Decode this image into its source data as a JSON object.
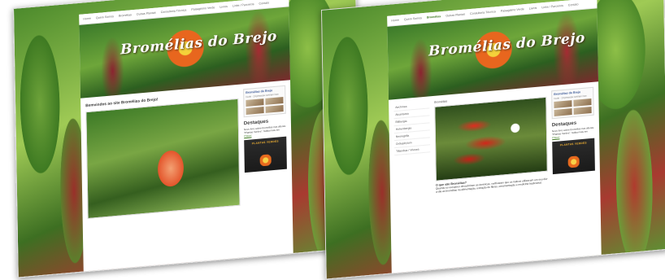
{
  "left": {
    "nav": [
      "Home",
      "Quem Somos",
      "Bromélias",
      "Outras Plantas",
      "Consultoria Técnica",
      "Paisagismo Verde",
      "Livros",
      "Links / Parceiros",
      "Contato"
    ],
    "site_title": "Bromélias do Brejo",
    "post_title": "Bemvindos ao site Bromélias do Brejo!",
    "fb_title": "Bromélias do Brejo",
    "fb_meta": "Curtir · 23 pessoas curtiram isso",
    "destaques_title": "Destaques",
    "destaques_text": "Novo livro sobre bromélias nas alturas: \"Plantas Verdes\". Saiba mais em",
    "destaques_link": "Clique!",
    "book_title": "PLANTAS VERDES"
  },
  "right": {
    "nav": [
      "Home",
      "Quem Somos",
      "Bromélias",
      "Outras Plantas",
      "Consultoria Técnica",
      "Paisagismo Verde",
      "Livros",
      "Links / Parceiros",
      "Contato"
    ],
    "active_nav": "Bromélias",
    "site_title": "Bromélias do Brejo",
    "section_label": "Bromélias",
    "side_menu": [
      "Aechmea",
      "Alcantarea",
      "Billbergia",
      "Hohenbergia",
      "Neoregelia",
      "Orthophytum",
      "Tillandsia / Vriesea"
    ],
    "caption_title": "O que são Bromélias?",
    "caption_text": "Quando os europeus descobriram as Américas, verificaram que os nativos utilizavam em seu dia-a-dia as bromélias na alimentação, extração de fibras, ornamentação e medicina tradicional.",
    "fb_title": "Bromélias do Brejo",
    "fb_meta": "Curtir · 23 pessoas curtiram isso",
    "destaques_title": "Destaques",
    "destaques_text": "Novo livro sobre bromélias nas alturas: \"Plantas Verdes\". Saiba mais em",
    "destaques_link": "Clique!",
    "book_title": "PLANTAS VERDES"
  }
}
